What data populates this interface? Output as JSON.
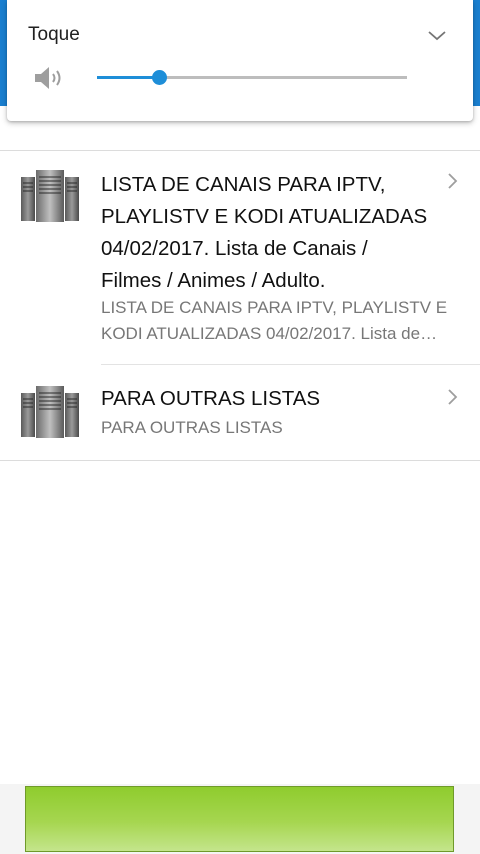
{
  "volume_panel": {
    "title": "Toque",
    "level": 0.2,
    "icons": {
      "speaker": "speaker-icon",
      "expand": "chevron-down-icon"
    },
    "accent_color": "#1e8ed8"
  },
  "list": {
    "items": [
      {
        "icon": "server-icon",
        "title": "LISTA DE CANAIS PARA IPTV, PLAYLISTV E KODI ATUALIZADAS 04/02/2017. Lista de Canais / Filmes / Animes / Adulto.",
        "subtitle": "LISTA DE CANAIS PARA IPTV, PLAYLISTV E KODI ATUALIZADAS 04/02/2017. Lista de Canais / Filmes / Animes / Adulto.",
        "chevron": "chevron-right-icon"
      },
      {
        "icon": "server-icon",
        "title": "PARA OUTRAS LISTAS",
        "subtitle": "PARA OUTRAS LISTAS",
        "chevron": "chevron-right-icon"
      }
    ]
  },
  "colors": {
    "header_blue": "#1a7fd0",
    "ad_green": "#8fcc2e"
  }
}
